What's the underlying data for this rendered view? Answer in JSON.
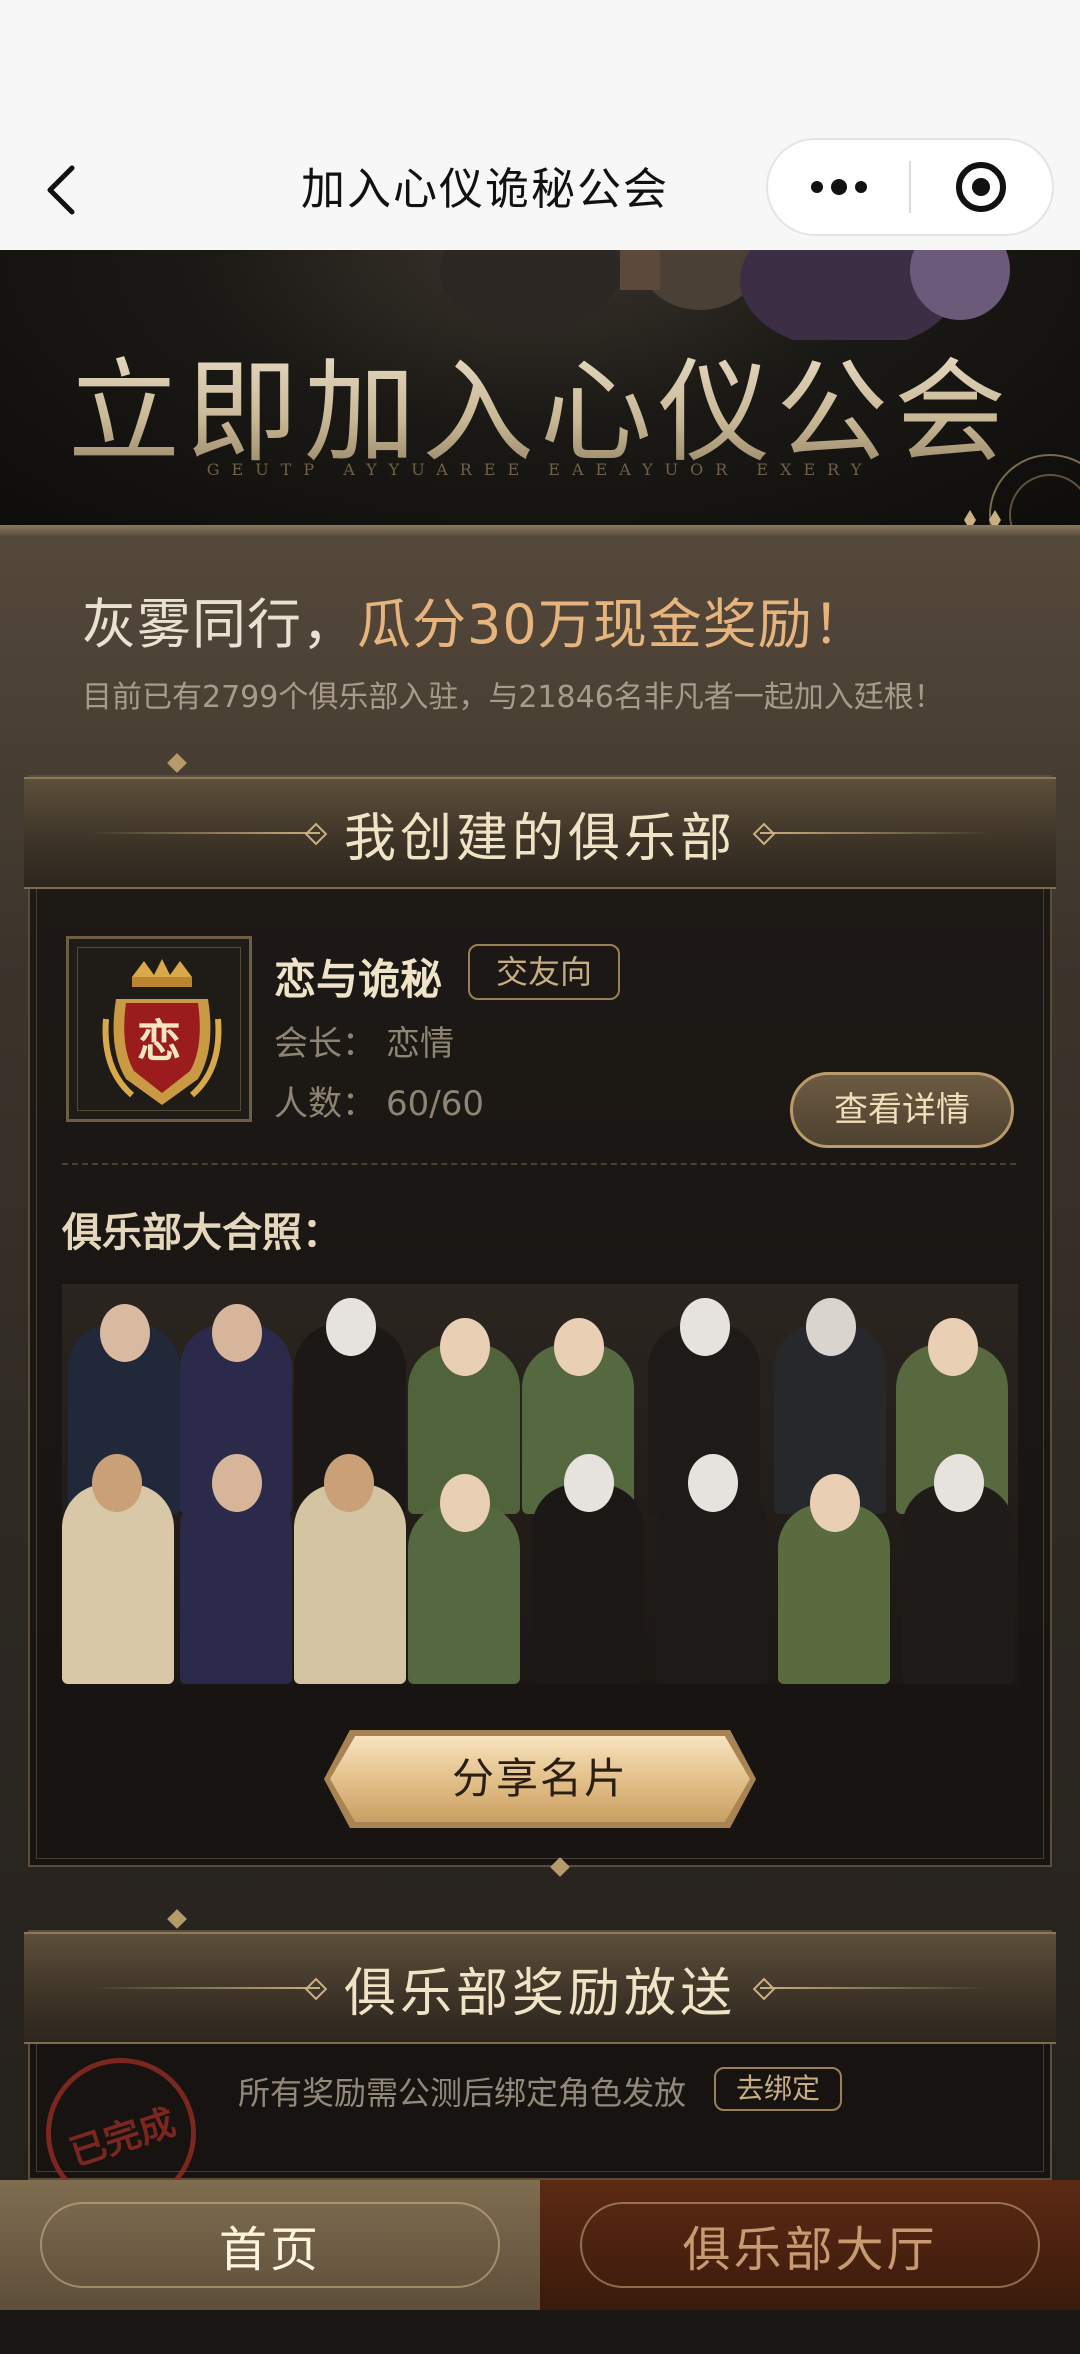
{
  "navbar": {
    "title": "加入心仪诡秘公会",
    "back_icon": "chevron-left-icon",
    "more_icon": "more-dots-icon",
    "close_icon": "target-circle-icon"
  },
  "banner": {
    "title": "立即加入心仪公会",
    "subtitle": "GEUTP AYYUAREE EAEAYUOR EXERY"
  },
  "promo": {
    "line_prefix": "灰雾同行，",
    "line_accent": "瓜分30万现金奖励！",
    "subline": "目前已有2799个俱乐部入驻，与21846名非凡者一起加入廷根！"
  },
  "my_club": {
    "section_title": "我创建的俱乐部",
    "emblem_char": "恋",
    "name": "恋与诡秘",
    "tag": "交友向",
    "leader_label": "会长：",
    "leader_value": "恋情",
    "count_label": "人数：",
    "count_value": "60/60",
    "detail_button": "查看详情",
    "photo_label": "俱乐部大合照：",
    "share_button": "分享名片"
  },
  "rewards": {
    "section_title": "俱乐部奖励放送",
    "note": "所有奖励需公测后绑定角色发放",
    "bind_button": "去绑定",
    "stamp_text": "已完成"
  },
  "tabbar": {
    "home": "首页",
    "hall": "俱乐部大厅"
  },
  "colors": {
    "accent_gold": "#e6b47c",
    "panel_gold": "#c9af82",
    "hall_tab": "#5c2a14"
  }
}
